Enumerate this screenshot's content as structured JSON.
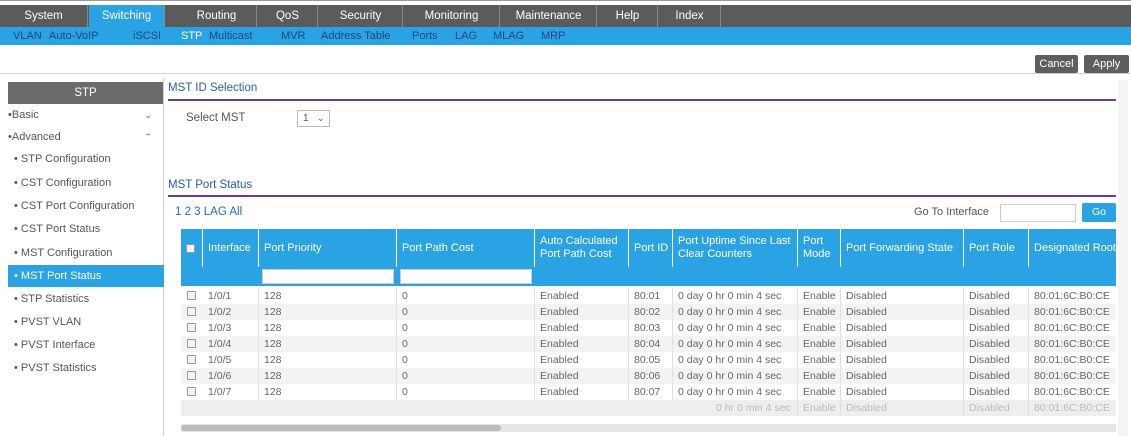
{
  "top_nav": [
    {
      "label": "System",
      "active": false
    },
    {
      "label": "Switching",
      "active": true
    },
    {
      "label": "Routing",
      "active": false
    },
    {
      "label": "QoS",
      "active": false
    },
    {
      "label": "Security",
      "active": false
    },
    {
      "label": "Monitoring",
      "active": false
    },
    {
      "label": "Maintenance",
      "active": false
    },
    {
      "label": "Help",
      "active": false
    },
    {
      "label": "Index",
      "active": false
    }
  ],
  "sub_nav": [
    {
      "label": "VLAN",
      "active": false
    },
    {
      "label": "Auto-VoIP",
      "active": false
    },
    {
      "label": "iSCSI",
      "active": false
    },
    {
      "label": "STP",
      "active": true
    },
    {
      "label": "Multicast",
      "active": false
    },
    {
      "label": "MVR",
      "active": false
    },
    {
      "label": "Address Table",
      "active": false
    },
    {
      "label": "Ports",
      "active": false
    },
    {
      "label": "LAG",
      "active": false
    },
    {
      "label": "MLAG",
      "active": false
    },
    {
      "label": "MRP",
      "active": false
    }
  ],
  "actions": {
    "cancel": "Cancel",
    "apply": "Apply"
  },
  "sidebar": {
    "title": "STP",
    "groups": [
      {
        "label": "Basic",
        "chevron": "⌄"
      },
      {
        "label": "Advanced",
        "chevron": "⌃"
      }
    ],
    "items": [
      {
        "label": "STP Configuration",
        "active": false
      },
      {
        "label": "CST Configuration",
        "active": false
      },
      {
        "label": "CST Port Configuration",
        "active": false
      },
      {
        "label": "CST Port Status",
        "active": false
      },
      {
        "label": "MST Configuration",
        "active": false
      },
      {
        "label": "MST Port Status",
        "active": true
      },
      {
        "label": "STP Statistics",
        "active": false
      },
      {
        "label": "PVST VLAN",
        "active": false
      },
      {
        "label": "PVST Interface",
        "active": false
      },
      {
        "label": "PVST Statistics",
        "active": false
      }
    ]
  },
  "mst_selection": {
    "title": "MST ID Selection",
    "select_label": "Select MST",
    "select_value": "1"
  },
  "port_status": {
    "title": "MST Port Status",
    "pager": "1 2 3 LAG All",
    "goto_label": "Go To Interface",
    "go_button": "Go",
    "columns": [
      "Interface",
      "Port Priority",
      "Port Path Cost",
      "Auto Calculated Port Path Cost",
      "Port ID",
      "Port Uptime Since Last Clear Counters",
      "Port Mode",
      "Port Forwarding State",
      "Port Role",
      "Designated Root"
    ],
    "rows": [
      [
        "1/0/1",
        "128",
        "0",
        "Enabled",
        "80:01",
        "0 day 0 hr 0 min 4 sec",
        "Enable",
        "Disabled",
        "Disabled",
        "80:01:6C:B0:CE"
      ],
      [
        "1/0/2",
        "128",
        "0",
        "Enabled",
        "80:02",
        "0 day 0 hr 0 min 4 sec",
        "Enable",
        "Disabled",
        "Disabled",
        "80:01:6C:B0:CE"
      ],
      [
        "1/0/3",
        "128",
        "0",
        "Enabled",
        "80:03",
        "0 day 0 hr 0 min 4 sec",
        "Enable",
        "Disabled",
        "Disabled",
        "80:01:6C:B0:CE"
      ],
      [
        "1/0/4",
        "128",
        "0",
        "Enabled",
        "80:04",
        "0 day 0 hr 0 min 4 sec",
        "Enable",
        "Disabled",
        "Disabled",
        "80:01:6C:B0:CE"
      ],
      [
        "1/0/5",
        "128",
        "0",
        "Enabled",
        "80:05",
        "0 day 0 hr 0 min 4 sec",
        "Enable",
        "Disabled",
        "Disabled",
        "80:01:6C:B0:CE"
      ],
      [
        "1/0/6",
        "128",
        "0",
        "Enabled",
        "80:06",
        "0 day 0 hr 0 min 4 sec",
        "Enable",
        "Disabled",
        "Disabled",
        "80:01:6C:B0:CE"
      ],
      [
        "1/0/7",
        "128",
        "0",
        "Enabled",
        "80:07",
        "0 day 0 hr 0 min 4 sec",
        "Enable",
        "Disabled",
        "Disabled",
        "80:01:6C:B0:CE"
      ]
    ],
    "partial_row": [
      "0 hr 0 min 4 sec",
      "Enable",
      "Disabled",
      "Disabled",
      "80:01:6C:B0:CE"
    ]
  },
  "colors": {
    "accent": "#29a3e3",
    "topnav": "#5b5b5b",
    "section_line": "#6a3aa0"
  }
}
